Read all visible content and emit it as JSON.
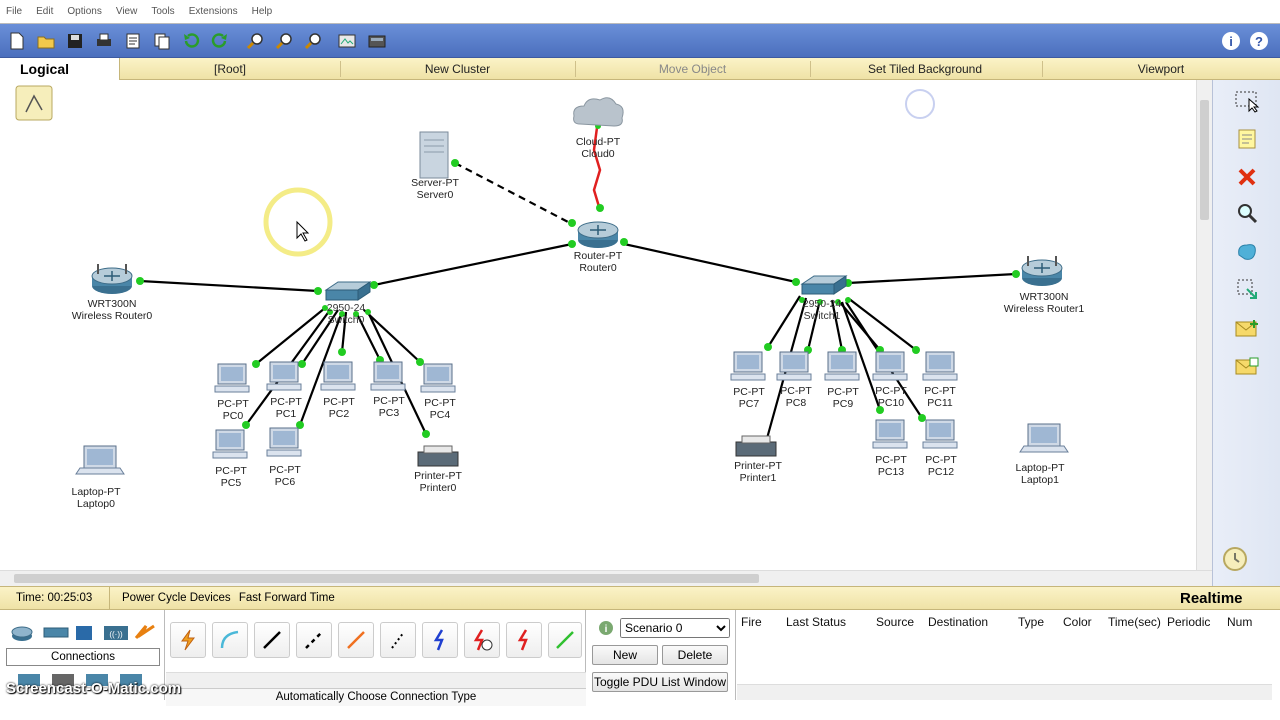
{
  "menu": {
    "items": [
      "File",
      "Edit",
      "Options",
      "View",
      "Tools",
      "Extensions",
      "Help"
    ]
  },
  "workspace": {
    "mode": "Logical",
    "root": "[Root]",
    "new_cluster": "New Cluster",
    "move_object": "Move Object",
    "tiled_bg": "Set Tiled Background",
    "viewport": "Viewport"
  },
  "devices": {
    "cloud0": [
      "Cloud-PT",
      "Cloud0"
    ],
    "server0": [
      "Server-PT",
      "Server0"
    ],
    "router0": [
      "Router-PT",
      "Router0"
    ],
    "wr0": [
      "WRT300N",
      "Wireless Router0"
    ],
    "wr1": [
      "WRT300N",
      "Wireless Router1"
    ],
    "switch0": [
      "2950-24",
      "Switch0"
    ],
    "switch1": [
      "2950-24",
      "Switch1"
    ],
    "pc0": [
      "PC-PT",
      "PC0"
    ],
    "pc1": [
      "PC-PT",
      "PC1"
    ],
    "pc2": [
      "PC-PT",
      "PC2"
    ],
    "pc3": [
      "PC-PT",
      "PC3"
    ],
    "pc4": [
      "PC-PT",
      "PC4"
    ],
    "pc5": [
      "PC-PT",
      "PC5"
    ],
    "pc6": [
      "PC-PT",
      "PC6"
    ],
    "pc7": [
      "PC-PT",
      "PC7"
    ],
    "pc8": [
      "PC-PT",
      "PC8"
    ],
    "pc9": [
      "PC-PT",
      "PC9"
    ],
    "pc10": [
      "PC-PT",
      "PC10"
    ],
    "pc11": [
      "PC-PT",
      "PC11"
    ],
    "pc12": [
      "PC-PT",
      "PC12"
    ],
    "pc13": [
      "PC-PT",
      "PC13"
    ],
    "printer0": [
      "Printer-PT",
      "Printer0"
    ],
    "printer1": [
      "Printer-PT",
      "Printer1"
    ],
    "laptop0": [
      "Laptop-PT",
      "Laptop0"
    ],
    "laptop1": [
      "Laptop-PT",
      "Laptop1"
    ]
  },
  "status": {
    "time": "Time: 00:25:03",
    "power_cycle": "Power Cycle Devices",
    "fast_forward": "Fast Forward Time",
    "mode": "Realtime"
  },
  "bottom": {
    "connections_label": "Connections",
    "auto_connection": "Automatically Choose Connection Type",
    "scenario_value": "Scenario 0",
    "new_btn": "New",
    "delete_btn": "Delete",
    "toggle_pdu": "Toggle PDU List Window",
    "pdu_headers": [
      "Fire",
      "Last Status",
      "Source",
      "Destination",
      "Type",
      "Color",
      "Time(sec)",
      "Periodic",
      "Num"
    ]
  },
  "watermark": "Screencast-O-Matic.com",
  "colors": {
    "link": "#000000",
    "serial": "#e02020",
    "crossover": "#000000",
    "port_up": "#22cc22",
    "toolbar": "#5a7fcb",
    "highlight": "#f4e87a"
  }
}
